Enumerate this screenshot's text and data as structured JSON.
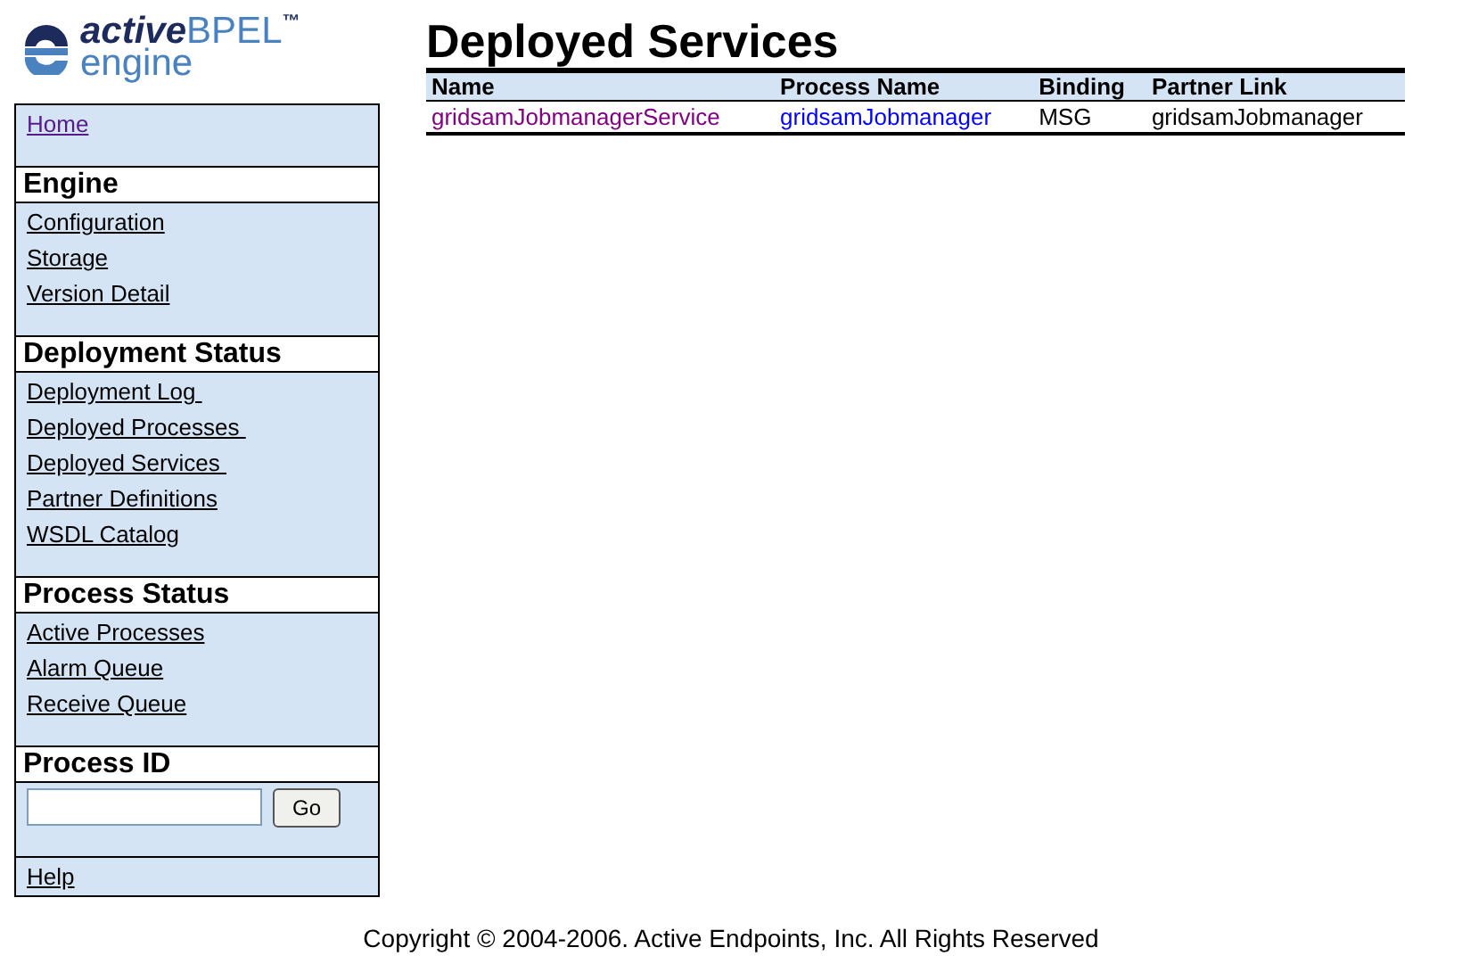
{
  "logo": {
    "word1": "active",
    "word2": "BPEL",
    "mark": "™",
    "line2": "engine"
  },
  "sidebar": {
    "sections": [
      {
        "kind": "links",
        "links": [
          "Home"
        ]
      },
      {
        "kind": "links",
        "heading": "Engine",
        "links": [
          "Configuration",
          "Storage",
          "Version Detail"
        ]
      },
      {
        "kind": "links",
        "heading": "Deployment Status",
        "links": [
          "Deployment Log ",
          "Deployed Processes ",
          "Deployed Services ",
          "Partner Definitions",
          "WSDL Catalog"
        ]
      },
      {
        "kind": "links",
        "heading": "Process Status",
        "links": [
          "Active Processes",
          "Alarm Queue",
          "Receive Queue"
        ]
      },
      {
        "kind": "form",
        "heading": "Process ID",
        "button": "Go"
      },
      {
        "kind": "footer",
        "links": [
          "Help"
        ]
      }
    ]
  },
  "page": {
    "title": "Deployed Services",
    "table": {
      "columns": [
        "Name",
        "Process Name",
        "Binding",
        "Partner Link"
      ],
      "rows": [
        [
          {
            "kind": "link",
            "text": "gridsamJobmanagerService",
            "visited": true
          },
          {
            "kind": "link",
            "text": "gridsamJobmanager",
            "visited": false
          },
          {
            "kind": "text",
            "text": "MSG"
          },
          {
            "kind": "text",
            "text": "gridsamJobmanager"
          }
        ]
      ]
    }
  },
  "footer": "Copyright © 2004-2006. Active Endpoints, Inc. All Rights Reserved"
}
